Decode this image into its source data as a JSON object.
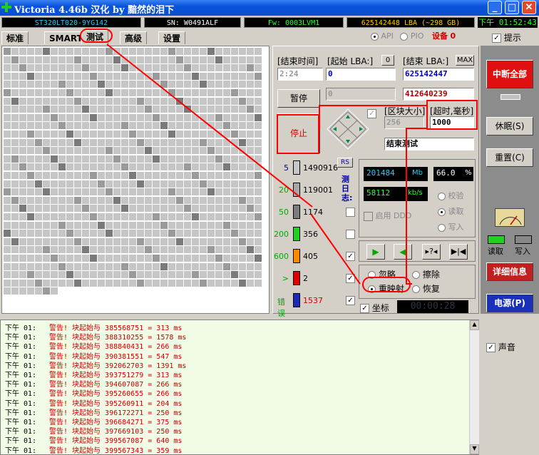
{
  "window": {
    "title": "Victoria 4.46b 汉化 by 黯然的泪下",
    "btn_min": "_",
    "btn_max": "□",
    "btn_close": "✕"
  },
  "info": {
    "model": "ST320LT020-9YG142",
    "sn": "SN: W0491ALF",
    "fw": "Fw: 0003LVM1",
    "lba": "625142448 LBA (~298 GB)",
    "clock": "下午 01:52:43"
  },
  "tabs": [
    "标准",
    "SMART",
    "测试",
    "高级",
    "设置"
  ],
  "opts": {
    "api": "API",
    "pio": "PIO",
    "device_label": "设备",
    "device_num": "0",
    "hint": "提示"
  },
  "ctrl": {
    "end_time_label": "[结束时间]",
    "start_lba_label": "[起始 LBA:]",
    "start_btn": "0",
    "end_lba_label": "[结束 LBA:]",
    "max_btn": "MAX",
    "time_value": "2:24",
    "start_value": "0",
    "end_value": "625142447",
    "pause": "暂停",
    "cur_left": "0",
    "cur_value": "412640239",
    "stop": "停止",
    "block_label": "[区块大小]",
    "timeout_label": "[超时,毫秒]",
    "block_value": "256",
    "timeout_value": "1000",
    "mode_value": "结束测试",
    "rs": "RS",
    "log_vertical": "测日志:",
    "mb_value": "201484",
    "mb_unit": "Mb",
    "pct_value": "66.0",
    "pct_unit": "%",
    "speed_value": "58112",
    "speed_unit": "kb/s",
    "verify": "校验",
    "read": "读取",
    "write": "写入",
    "ddd": "启用 DDD",
    "ignore": "忽略",
    "erase": "擦除",
    "remap": "重映射",
    "restore": "恢复",
    "grid_label": "坐标",
    "elapsed": "00:00:28"
  },
  "legend": [
    {
      "label": "5",
      "count": "1490916",
      "color": "#c8c8c8"
    },
    {
      "label": "20",
      "count": "119001",
      "color": "#a8a8a8"
    },
    {
      "label": "50",
      "count": "1174",
      "color": "#7c7c7c"
    },
    {
      "label": "200",
      "count": "356",
      "color": "#1fd21f"
    },
    {
      "label": "600",
      "count": "405",
      "color": "#ff8a00"
    },
    {
      "label": ">",
      "count": "2",
      "color": "#e00000"
    },
    {
      "label": "错误",
      "count": "1537",
      "color": "#1a2ab8"
    }
  ],
  "side": {
    "break_all": "中断全部",
    "sleep": "休眠(S)",
    "reset": "重置(C)",
    "read": "读取",
    "write": "写入",
    "detail": "详细信息",
    "power": "电源(P)",
    "sound": "声音"
  },
  "log": [
    {
      "time": "下午 01:",
      "msg": "警告! 块起始与 385568751 = 313 ms"
    },
    {
      "time": "下午 01:",
      "msg": "警告! 块起始与 388310255 = 1578 ms"
    },
    {
      "time": "下午 01:",
      "msg": "警告! 块起始与 388840431 = 266 ms"
    },
    {
      "time": "下午 01:",
      "msg": "警告! 块起始与 390381551 = 547 ms"
    },
    {
      "time": "下午 01:",
      "msg": "警告! 块起始与 392062703 = 1391 ms"
    },
    {
      "time": "下午 01:",
      "msg": "警告! 块起始与 393751279 = 313 ms"
    },
    {
      "time": "下午 01:",
      "msg": "警告! 块起始与 394607087 = 266 ms"
    },
    {
      "time": "下午 01:",
      "msg": "警告! 块起始与 395260655 = 266 ms"
    },
    {
      "time": "下午 01:",
      "msg": "警告! 块起始与 395260911 = 204 ms"
    },
    {
      "time": "下午 01:",
      "msg": "警告! 块起始与 396172271 = 250 ms"
    },
    {
      "time": "下午 01:",
      "msg": "警告! 块起始与 396684271 = 375 ms"
    },
    {
      "time": "下午 01:",
      "msg": "警告! 块起始与 397669103 = 250 ms"
    },
    {
      "time": "下午 01:",
      "msg": "警告! 块起始与 399567087 = 640 ms"
    },
    {
      "time": "下午 01:",
      "msg": "警告! 块起始与 399567343 = 359 ms"
    }
  ]
}
